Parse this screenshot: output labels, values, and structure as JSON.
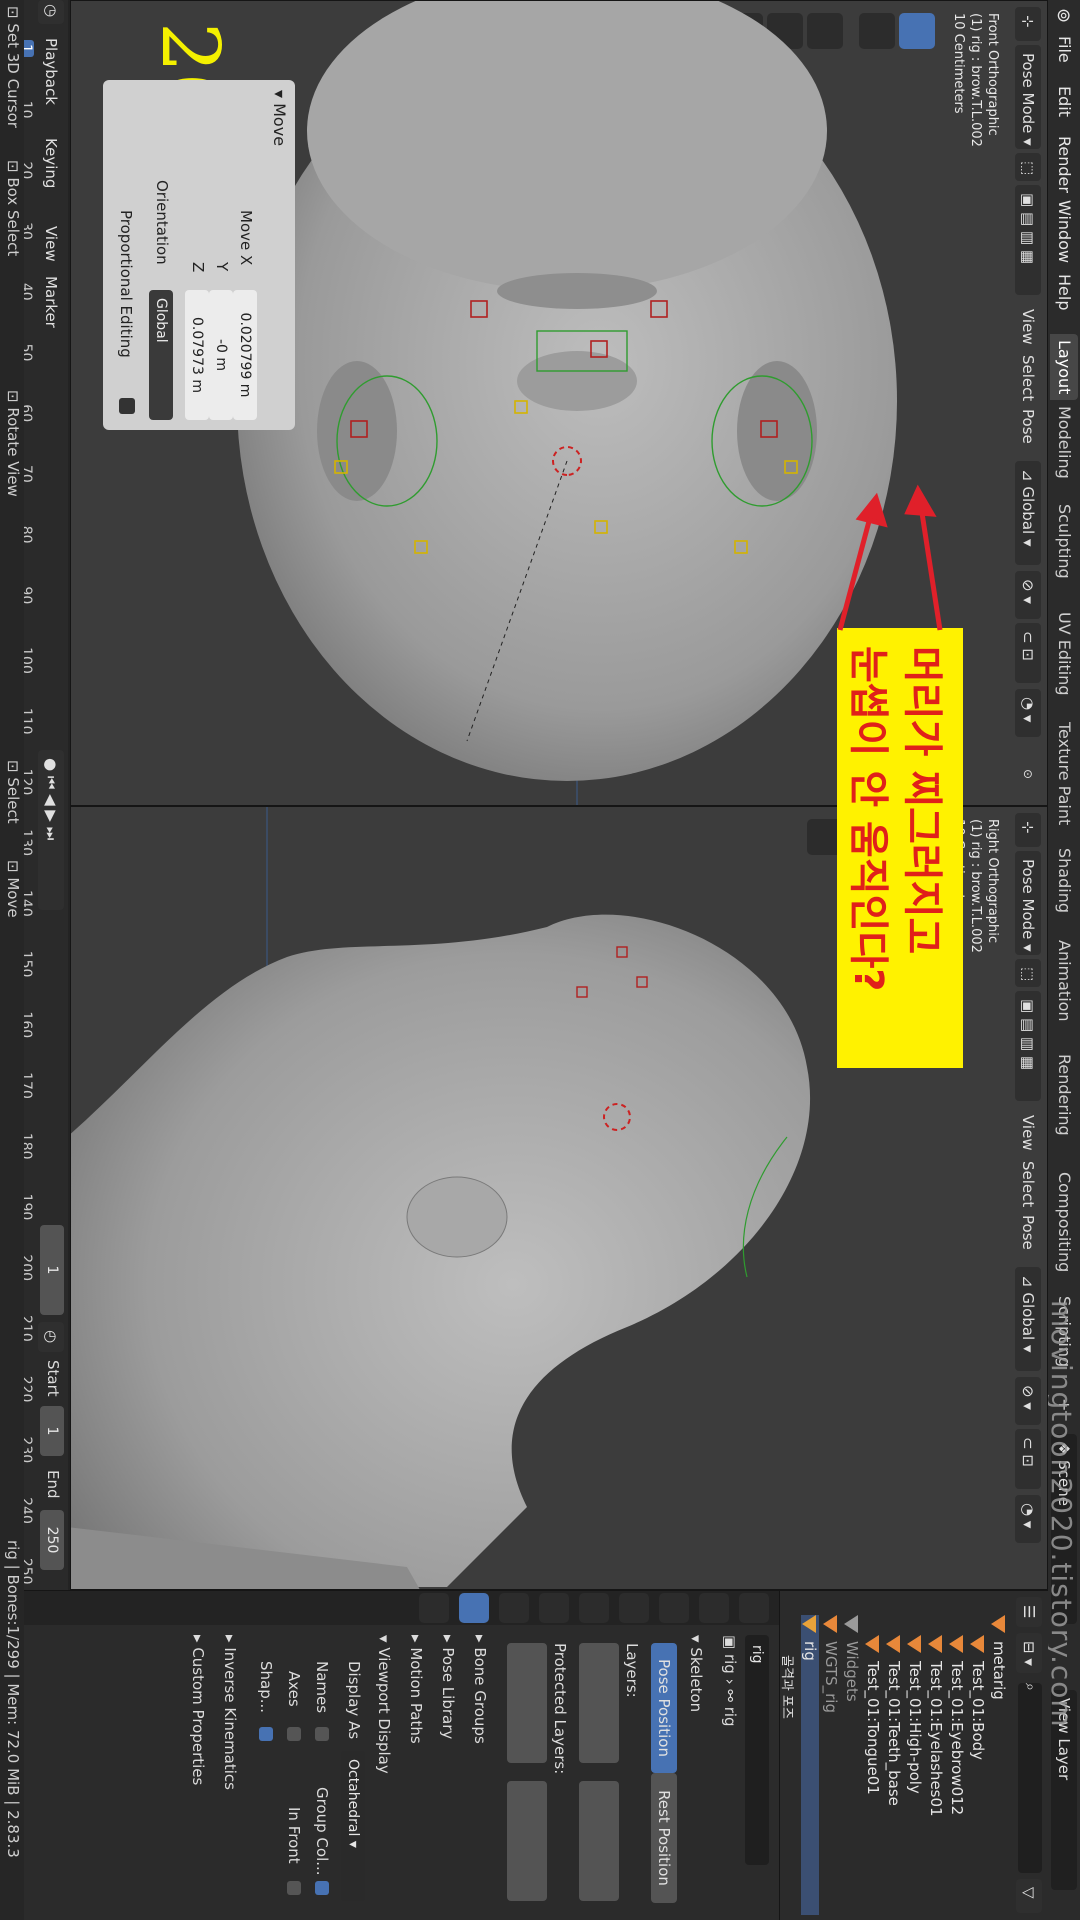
{
  "watermark": "movingtoon2020.tistory.com",
  "frame_badge": "20",
  "annotation_text": [
    "머리가 찌그러지고",
    "눈썹이 안 움직인다?"
  ],
  "menu": [
    "File",
    "Edit",
    "Render",
    "Window",
    "Help"
  ],
  "workspace_tabs": [
    "Layout",
    "Modeling",
    "Sculpting",
    "UV Editing",
    "Texture Paint",
    "Shading",
    "Animation",
    "Rendering",
    "Compositing",
    "Scripting"
  ],
  "scene_label": "Scene",
  "view_layer_label": "View Layer",
  "viewport_left": {
    "mode": "Pose Mode",
    "menus": [
      "View",
      "Select",
      "Pose"
    ],
    "orientation": "Global",
    "pose_options": "Pose Options",
    "info": [
      "Front Orthographic",
      "(1) rig : brow.T.L.002",
      "10 Centimeters"
    ]
  },
  "viewport_right": {
    "mode": "Pose Mode",
    "menus": [
      "View",
      "Select",
      "Pose"
    ],
    "orientation": "Global",
    "pose_options": "Pose Options",
    "info": [
      "Right Orthographic",
      "(1) rig : brow.T.L.002",
      "10 Centimeters"
    ]
  },
  "move_panel": {
    "title": "Move",
    "labels": [
      "Move X",
      "Y",
      "Z"
    ],
    "values": [
      "0.020799 m",
      "-0 m",
      "0.07973 m"
    ],
    "orientation_label": "Orientation",
    "orientation_value": "Global",
    "proportional": "Proportional Editing"
  },
  "timeline": {
    "menus": [
      "Playback",
      "Keying",
      "View",
      "Marker"
    ],
    "current_frame": "1",
    "ticks": [
      "1",
      "10",
      "20",
      "30",
      "40",
      "50",
      "60",
      "70",
      "80",
      "90",
      "100",
      "110",
      "120",
      "130",
      "140",
      "150",
      "160",
      "170",
      "180",
      "190",
      "200",
      "210",
      "220",
      "230",
      "240",
      "250"
    ],
    "frame_field": "1",
    "start_label": "Start",
    "start_value": "1",
    "end_label": "End",
    "end_value": "250"
  },
  "outliner": {
    "items": [
      "metarig",
      "Test_01:Body",
      "Test_01:Eyebrow012",
      "Test_01:Eyelashes01",
      "Test_01:High-poly",
      "Test_01:Teeth_base",
      "Test_01:Tongue01",
      "Widgets",
      "WGTS_rig",
      "rig"
    ],
    "sub_label": "골격과 포즈"
  },
  "properties": {
    "object_name": "rig",
    "breadcrumb": [
      "rig",
      "rig"
    ],
    "skeleton": "Skeleton",
    "pose_position": "Pose Position",
    "rest_position": "Rest Position",
    "layers": "Layers:",
    "protected_layers": "Protected Layers:",
    "sections": [
      "Bone Groups",
      "Pose Library",
      "Motion Paths",
      "Viewport Display"
    ],
    "display_as_label": "Display As",
    "display_as_value": "Octahedral",
    "names": "Names",
    "group_colors": "Group Col...",
    "axes": "Axes",
    "in_front": "In Front",
    "shapes": "Shap...",
    "ik": "Inverse Kinematics",
    "custom_props": "Custom Properties"
  },
  "status_bar": {
    "left": [
      "Set 3D Cursor",
      "Box Select",
      "Rotate View"
    ],
    "mid": [
      "Select",
      "Move"
    ],
    "right": "rig | Bones:1/299 | Mem: 72.0 MiB | 2.83.3"
  },
  "colors": {
    "accent": "#4772b3",
    "annotation_bg": "#fff200",
    "annotation_text": "#e0201a",
    "arrow": "#e0202a",
    "badge": "#f4f000"
  }
}
